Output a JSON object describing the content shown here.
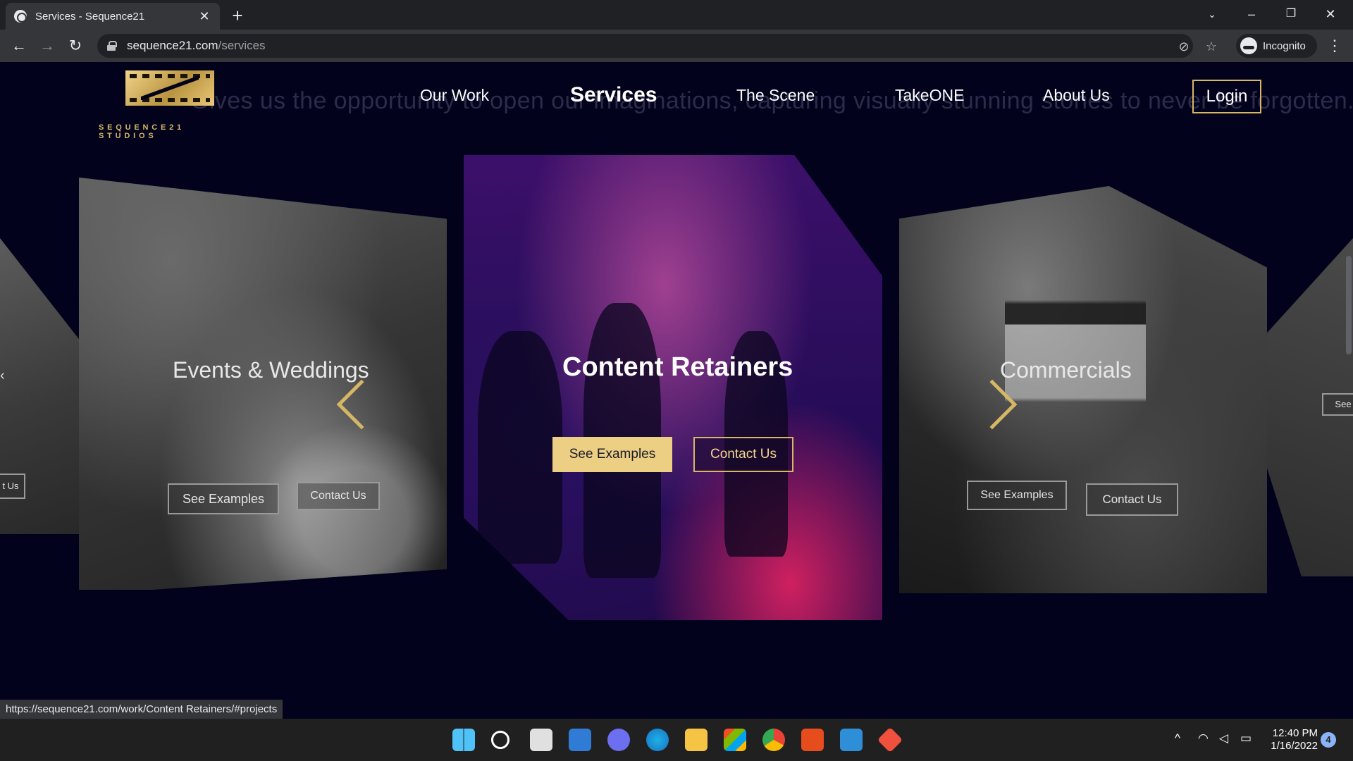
{
  "browser": {
    "tab_title": "Services - Sequence21",
    "url_host": "sequence21.com",
    "url_path": "/services",
    "profile_label": "Incognito",
    "status_url": "https://sequence21.com/work/Content Retainers/#projects"
  },
  "site": {
    "logo_text": "SEQUENCE21 STUDIOS",
    "ghost_text": "Gives us the opportunity to open our imaginations, capturing visually stunning stories to never be forgotten.",
    "nav": [
      "Our Work",
      "Services",
      "The Scene",
      "TakeONE",
      "About Us"
    ],
    "login_label": "Login",
    "cards": {
      "far_left": {
        "button": "t Us"
      },
      "left": {
        "title": "Events & Weddings",
        "see_examples": "See Examples",
        "contact": "Contact Us"
      },
      "center": {
        "title": "Content Retainers",
        "see_examples": "See Examples",
        "contact": "Contact Us"
      },
      "right": {
        "title": "Commercials",
        "see_examples": "See Examples",
        "contact": "Contact Us"
      },
      "far_right": {
        "button": "See"
      }
    }
  },
  "taskbar": {
    "time": "12:40 PM",
    "date": "1/16/2022",
    "notification_count": "4"
  },
  "colors": {
    "page_bg": "#02021c",
    "gold": "#d6b766",
    "gold_fill": "#eccf83"
  }
}
